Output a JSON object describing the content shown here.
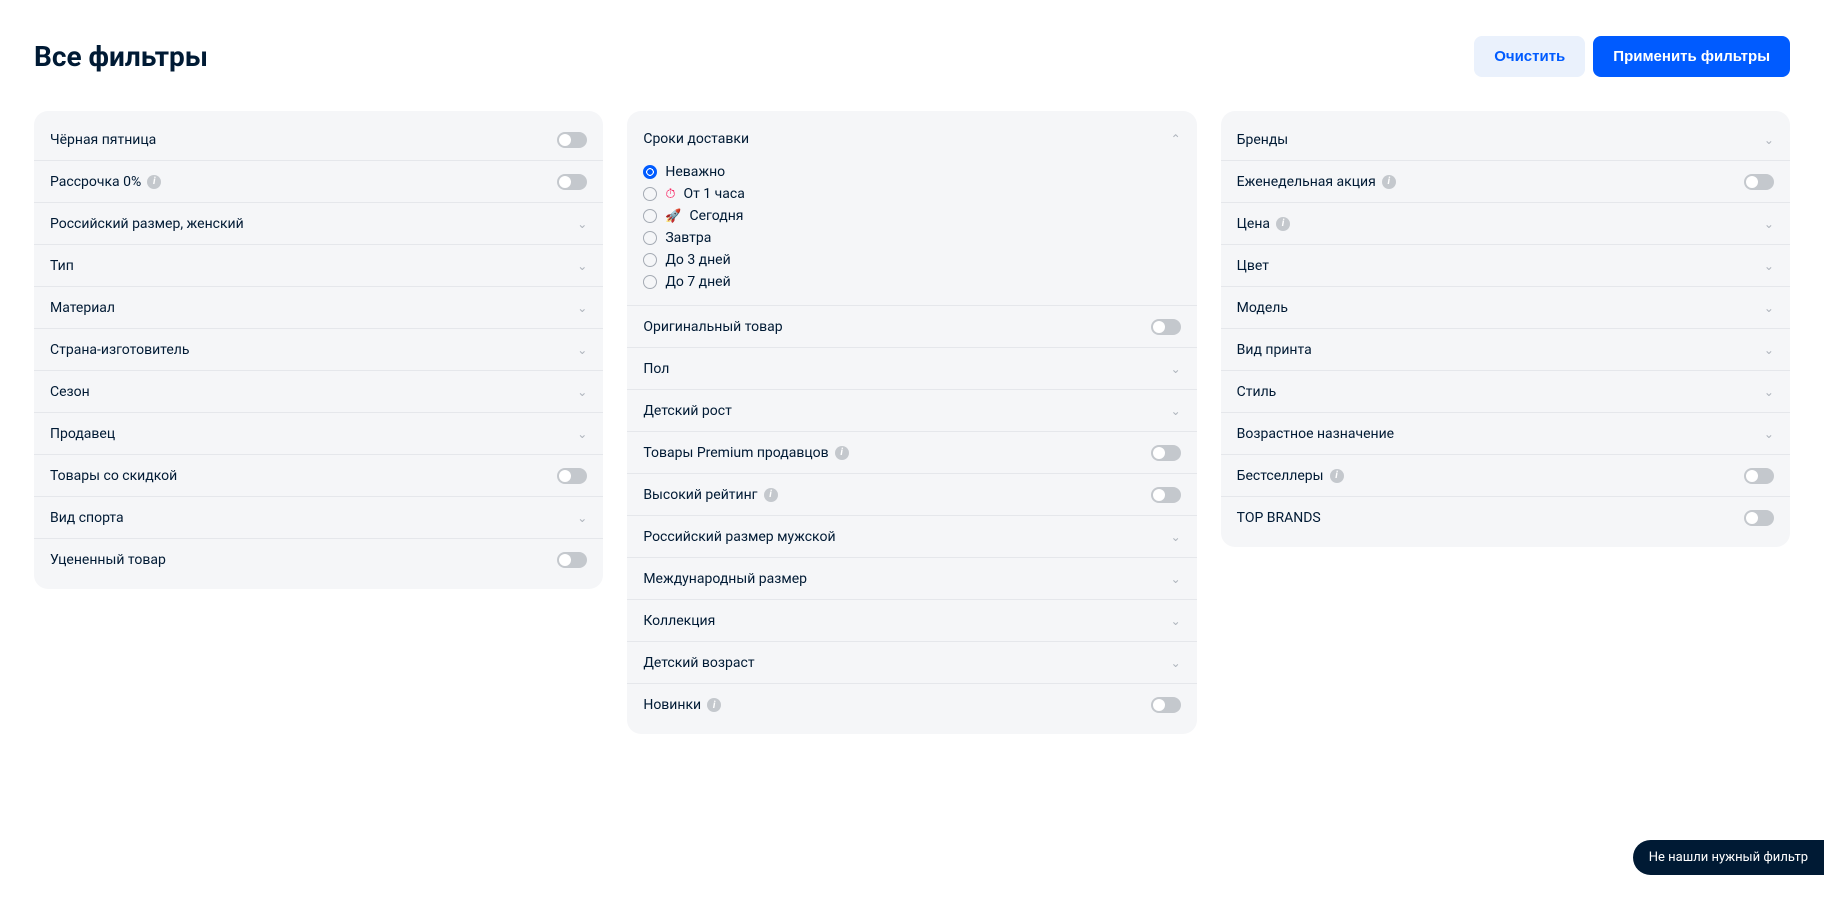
{
  "header": {
    "title": "Все фильтры",
    "clear_label": "Очистить",
    "apply_label": "Применить фильтры"
  },
  "col1": {
    "black_friday": "Чёрная пятница",
    "installment": "Рассрочка 0%",
    "size_women": "Российский размер, женский",
    "type": "Тип",
    "material": "Материал",
    "country": "Страна-изготовитель",
    "season": "Сезон",
    "seller": "Продавец",
    "discount": "Товары со скидкой",
    "sport": "Вид спорта",
    "markdown": "Уцененный товар"
  },
  "col2": {
    "delivery_title": "Сроки доставки",
    "delivery_options": {
      "any": "Неважно",
      "hour": "От 1 часа",
      "today": "Сегодня",
      "tomorrow": "Завтра",
      "days3": "До 3 дней",
      "days7": "До 7 дней"
    },
    "original": "Оригинальный товар",
    "gender": "Пол",
    "child_height": "Детский рост",
    "premium": "Товары Premium продавцов",
    "rating": "Высокий рейтинг",
    "size_men": "Российский размер мужской",
    "intl_size": "Международный размер",
    "collection": "Коллекция",
    "child_age": "Детский возраст",
    "novelty": "Новинки"
  },
  "col3": {
    "brands": "Бренды",
    "weekly": "Еженедельная акция",
    "price": "Цена",
    "color": "Цвет",
    "model": "Модель",
    "print": "Вид принта",
    "style": "Стиль",
    "age_purpose": "Возрастное назначение",
    "bestsellers": "Бестселлеры",
    "top_brands": "TOP BRANDS"
  },
  "floating": "Не нашли нужный фильтр"
}
